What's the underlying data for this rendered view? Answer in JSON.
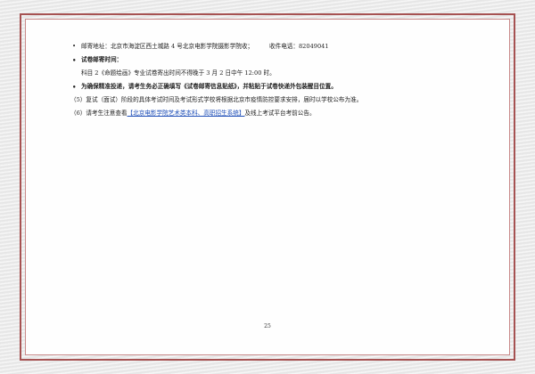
{
  "document": {
    "mail_address_label": "邮寄地址：",
    "mail_address": "北京市海淀区西土城路 4 号北京电影学院摄影学院收；",
    "phone_label": "收件电话：",
    "phone": "82049041",
    "deadline_heading": "试卷邮寄时间：",
    "deadline_text": "科目 2《命题绘画》专业试卷寄出时间不得晚于 3 月 2 日中午 12:00 时。",
    "delivery_notice": "为确保精准投递，请考生务必正确填写《试卷邮寄信息贴纸》，并粘贴于试卷快递外包装醒目位置。",
    "item5": "（5）复试（面试）阶段的具体考试时间及考试形式学校将根据北京市疫情防控要求安排，届时以学校公布为准。",
    "item6_prefix": "（6）请考生注意查看",
    "item6_link": "【北京电影学院艺术类本科、高职招生系统】",
    "item6_suffix": "及线上考试平台考前公告。",
    "page_number": "25"
  },
  "colors": {
    "frame": "#a65252",
    "link": "#1f4fb8"
  }
}
